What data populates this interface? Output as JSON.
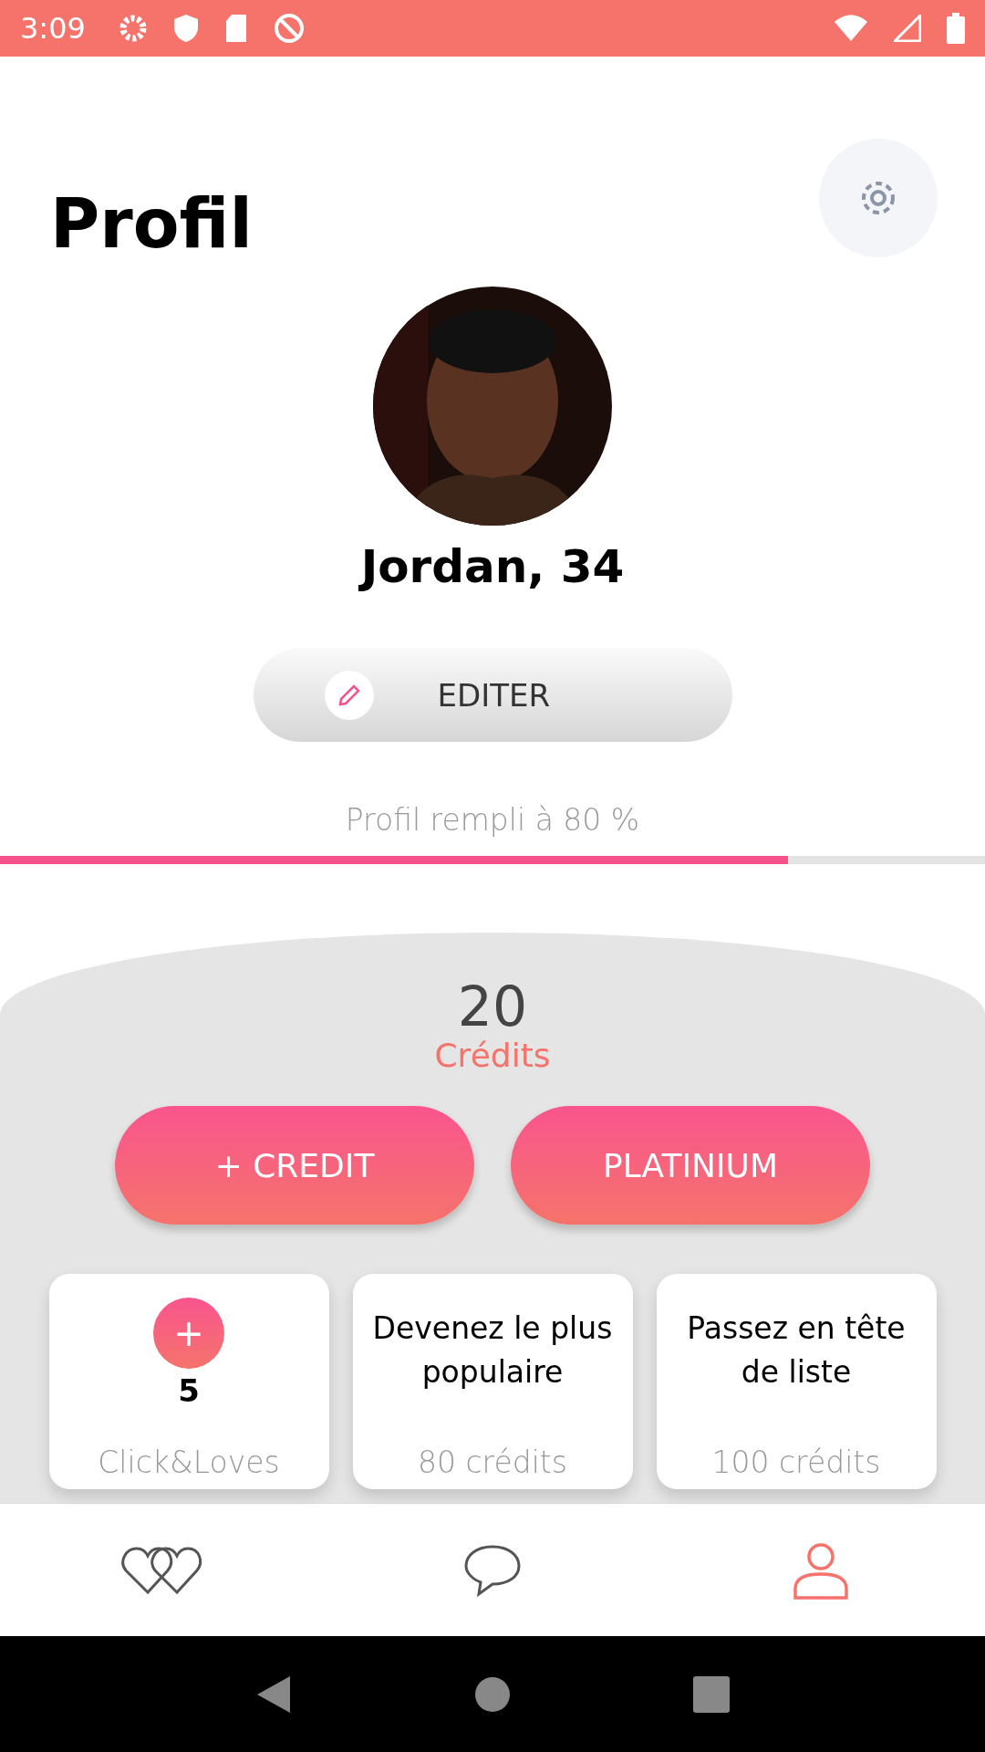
{
  "status_bar": {
    "time": "3:09"
  },
  "header": {
    "title": "Profil"
  },
  "profile": {
    "name": "Jordan, 34"
  },
  "edit_button": {
    "label": "EDITER"
  },
  "completion": {
    "label": "Profil rempli à 80 %",
    "level": 0.8
  },
  "credits": {
    "count": "20",
    "label": "Crédits"
  },
  "actions": [
    {
      "label": "+ CREDIT"
    },
    {
      "label": "PLATINIUM"
    }
  ],
  "cards": [
    {
      "kind": "counter",
      "button": "+",
      "value": "5",
      "caption": "Click&Loves"
    },
    {
      "kind": "offer",
      "title": "Devenez le plus populaire",
      "caption": "80 crédits"
    },
    {
      "kind": "offer",
      "title": "Passez en tête de liste",
      "caption": "100 crédits"
    }
  ],
  "bottom_nav": [
    {
      "kind": "hearts",
      "selected": false
    },
    {
      "kind": "chat",
      "selected": false
    },
    {
      "kind": "profile",
      "selected": true
    }
  ]
}
